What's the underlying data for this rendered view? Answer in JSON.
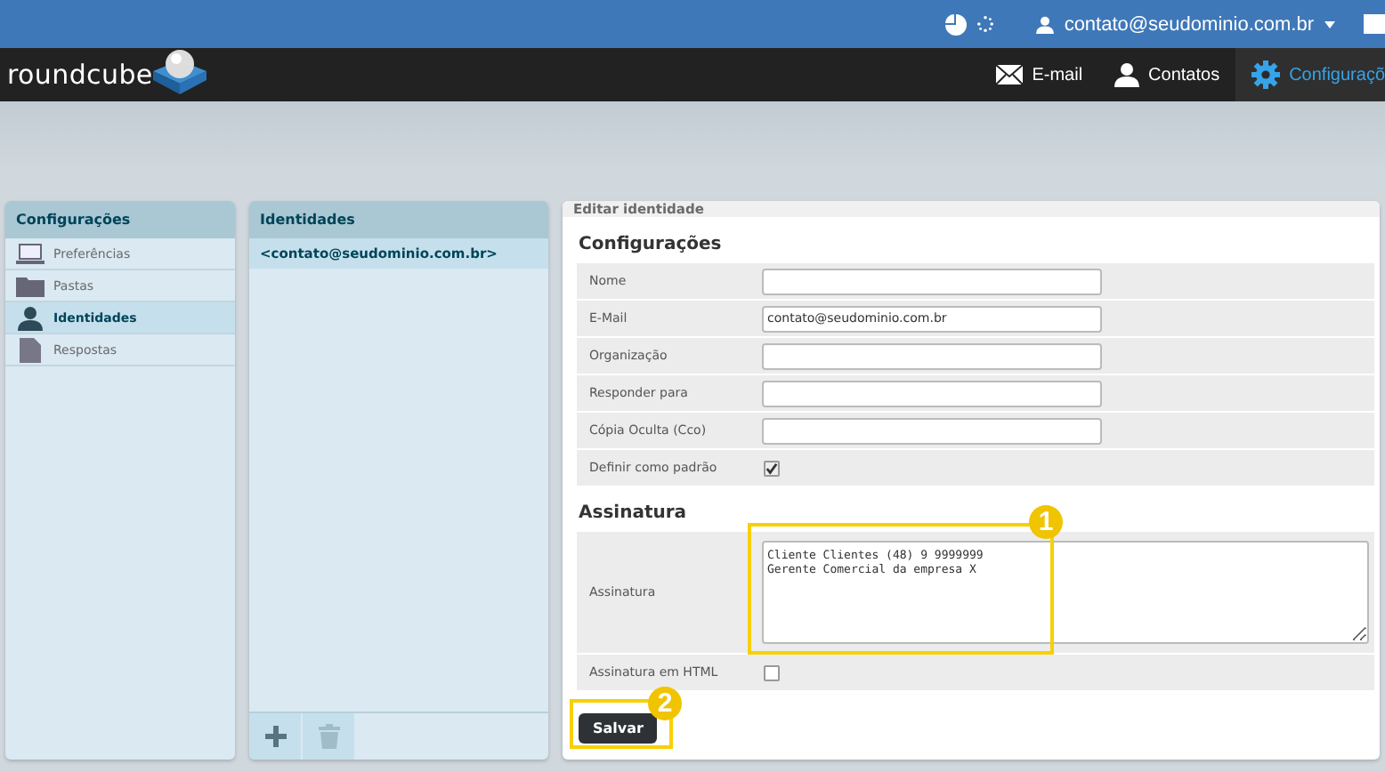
{
  "topbar": {
    "user": "contato@seudominio.com.br"
  },
  "header": {
    "logo": "roundcube",
    "nav": [
      {
        "label": "E-mail",
        "selected": false
      },
      {
        "label": "Contatos",
        "selected": false
      },
      {
        "label": "Configuraçõ",
        "selected": true
      }
    ]
  },
  "sections": {
    "title": "Configurações",
    "items": [
      {
        "label": "Preferências",
        "selected": false
      },
      {
        "label": "Pastas",
        "selected": false
      },
      {
        "label": "Identidades",
        "selected": true
      },
      {
        "label": "Respostas",
        "selected": false
      }
    ]
  },
  "identities": {
    "title": "Identidades",
    "items": [
      {
        "label": "<contato@seudominio.com.br>",
        "selected": true
      }
    ]
  },
  "editor": {
    "title": "Editar identidade",
    "groups": [
      {
        "title": "Configurações",
        "rows": [
          {
            "kind": "text",
            "label": "Nome"
          },
          {
            "kind": "text",
            "label": "E-Mail",
            "value": "contato@seudominio.com.br"
          },
          {
            "kind": "text",
            "label": "Organização"
          },
          {
            "kind": "text",
            "label": "Responder para"
          },
          {
            "kind": "text",
            "label": "Cópia Oculta (Cco)"
          },
          {
            "kind": "check",
            "label": "Definir como padrão",
            "checked": true
          }
        ]
      },
      {
        "title": "Assinatura",
        "rows": [
          {
            "kind": "textarea",
            "label": "Assinatura",
            "value": "Cliente Clientes (48) 9 9999999\nGerente Comercial da empresa X",
            "callout": "1"
          },
          {
            "kind": "check",
            "label": "Assinatura em HTML",
            "checked": false
          }
        ]
      }
    ],
    "save": {
      "label": "Salvar",
      "callout": "2"
    }
  }
}
